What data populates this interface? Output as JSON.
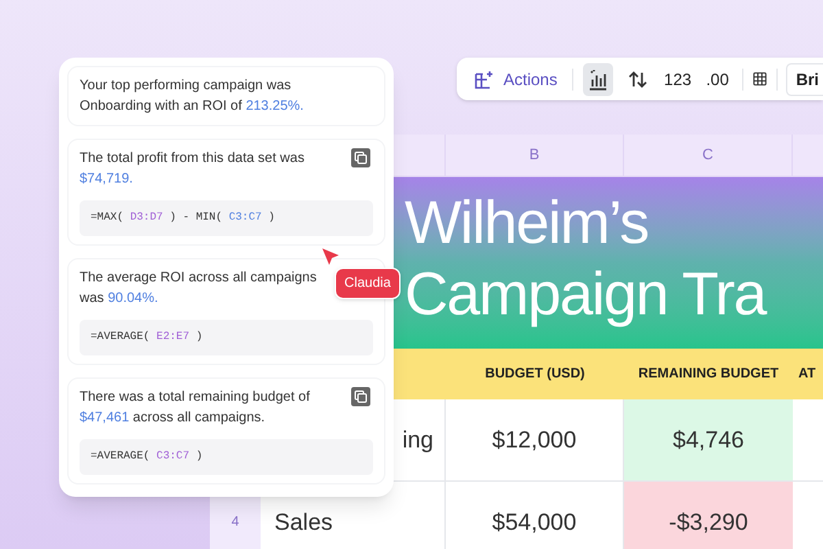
{
  "toolbar": {
    "actions_label": "Actions",
    "tools": [
      {
        "kind": "chart",
        "selected": true
      },
      {
        "kind": "sort",
        "selected": false
      },
      {
        "kind": "text",
        "label": "123",
        "selected": false
      },
      {
        "kind": "text",
        "label": ".00",
        "selected": false
      }
    ],
    "font_label": "Bri"
  },
  "sheet": {
    "columns": [
      {
        "letter": "B",
        "heading": "BUDGET (USD)"
      },
      {
        "letter": "C",
        "heading": "REMAINING BUDGET"
      },
      {
        "heading": "AT"
      }
    ],
    "title_lines": [
      "Wilheim’s",
      "Campaign Tra"
    ],
    "rows": [
      {
        "name": "ing",
        "name_cut": true,
        "budget": "$12,000",
        "remaining": "$4,746",
        "over_budget": false
      },
      {
        "number": "4",
        "name": "Sales",
        "name_cut": false,
        "budget": "$54,000",
        "remaining": "-$3,290",
        "over_budget": true
      }
    ]
  },
  "assistant_panel": {
    "messages": [
      {
        "text": "Your top performing campaign was Onboarding with an ROI of",
        "value": "213.25%.",
        "copy_button": false
      },
      {
        "text": "The total profit from this data set was",
        "value": "$74,719.",
        "copy_button": true,
        "formula": [
          {
            "kind": "text",
            "text": "=MAX("
          },
          {
            "kind": "ref",
            "text": "D3:D7",
            "color": "#a05fd6"
          },
          {
            "kind": "text",
            "text": ") - MIN("
          },
          {
            "kind": "ref",
            "text": "C3:C7",
            "color": "#4f7fe0"
          },
          {
            "kind": "text",
            "text": ")"
          }
        ]
      },
      {
        "text": "The average ROI across all campaigns was",
        "value": "90.04%.",
        "copy_button": false,
        "formula": [
          {
            "kind": "text",
            "text": "=AVERAGE("
          },
          {
            "kind": "ref",
            "text": "E2:E7",
            "color": "#a05fd6"
          },
          {
            "kind": "text",
            "text": ")"
          }
        ]
      },
      {
        "text": "There was a total remaining budget of",
        "value": "$47,461",
        "text_after": "across all campaigns.",
        "copy_button": true,
        "formula": [
          {
            "kind": "text",
            "text": "=AVERAGE("
          },
          {
            "kind": "ref",
            "text": "C3:C7",
            "color": "#a05fd6"
          },
          {
            "kind": "text",
            "text": ")"
          }
        ]
      }
    ]
  },
  "collaborator": {
    "name": "Claudia",
    "color": "#e8394a"
  }
}
